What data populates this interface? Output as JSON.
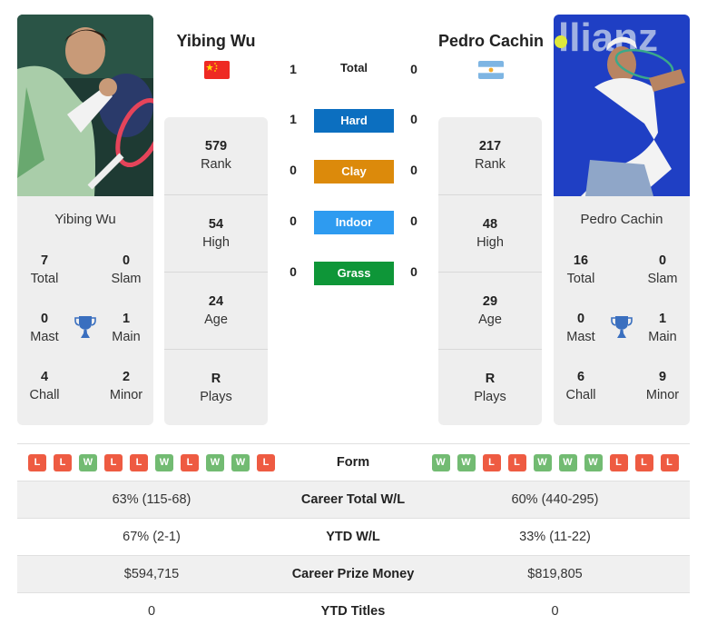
{
  "players": {
    "left": {
      "name": "Yibing Wu",
      "flag": "china-flag",
      "titles": {
        "total": {
          "value": "7",
          "label": "Total"
        },
        "slam": {
          "value": "0",
          "label": "Slam"
        },
        "mast": {
          "value": "0",
          "label": "Mast"
        },
        "main": {
          "value": "1",
          "label": "Main"
        },
        "chall": {
          "value": "4",
          "label": "Chall"
        },
        "minor": {
          "value": "2",
          "label": "Minor"
        }
      },
      "info": {
        "rank": {
          "value": "579",
          "label": "Rank"
        },
        "high": {
          "value": "54",
          "label": "High"
        },
        "age": {
          "value": "24",
          "label": "Age"
        },
        "plays": {
          "value": "R",
          "label": "Plays"
        }
      }
    },
    "right": {
      "name": "Pedro Cachin",
      "flag": "argentina-flag",
      "titles": {
        "total": {
          "value": "16",
          "label": "Total"
        },
        "slam": {
          "value": "0",
          "label": "Slam"
        },
        "mast": {
          "value": "0",
          "label": "Mast"
        },
        "main": {
          "value": "1",
          "label": "Main"
        },
        "chall": {
          "value": "6",
          "label": "Chall"
        },
        "minor": {
          "value": "9",
          "label": "Minor"
        }
      },
      "info": {
        "rank": {
          "value": "217",
          "label": "Rank"
        },
        "high": {
          "value": "48",
          "label": "High"
        },
        "age": {
          "value": "29",
          "label": "Age"
        },
        "plays": {
          "value": "R",
          "label": "Plays"
        }
      }
    }
  },
  "h2h": {
    "total": {
      "label": "Total",
      "left": "1",
      "right": "0"
    },
    "surfaces": [
      {
        "label": "Hard",
        "left": "1",
        "right": "0",
        "color": "#0c6fc0"
      },
      {
        "label": "Clay",
        "left": "0",
        "right": "0",
        "color": "#dc8a0b"
      },
      {
        "label": "Indoor",
        "left": "0",
        "right": "0",
        "color": "#2e9bf0"
      },
      {
        "label": "Grass",
        "left": "0",
        "right": "0",
        "color": "#0e9638"
      }
    ]
  },
  "form": {
    "label": "Form",
    "left": [
      "L",
      "L",
      "W",
      "L",
      "L",
      "W",
      "L",
      "W",
      "W",
      "L"
    ],
    "right": [
      "W",
      "W",
      "L",
      "L",
      "W",
      "W",
      "W",
      "L",
      "L",
      "L"
    ],
    "colors": {
      "W": "#72bb72",
      "L": "#ee5b42"
    }
  },
  "stats": [
    {
      "label": "Career Total W/L",
      "left": "63% (115-68)",
      "right": "60% (440-295)"
    },
    {
      "label": "YTD W/L",
      "left": "67% (2-1)",
      "right": "33% (11-22)"
    },
    {
      "label": "Career Prize Money",
      "left": "$594,715",
      "right": "$819,805"
    },
    {
      "label": "YTD Titles",
      "left": "0",
      "right": "0"
    }
  ]
}
